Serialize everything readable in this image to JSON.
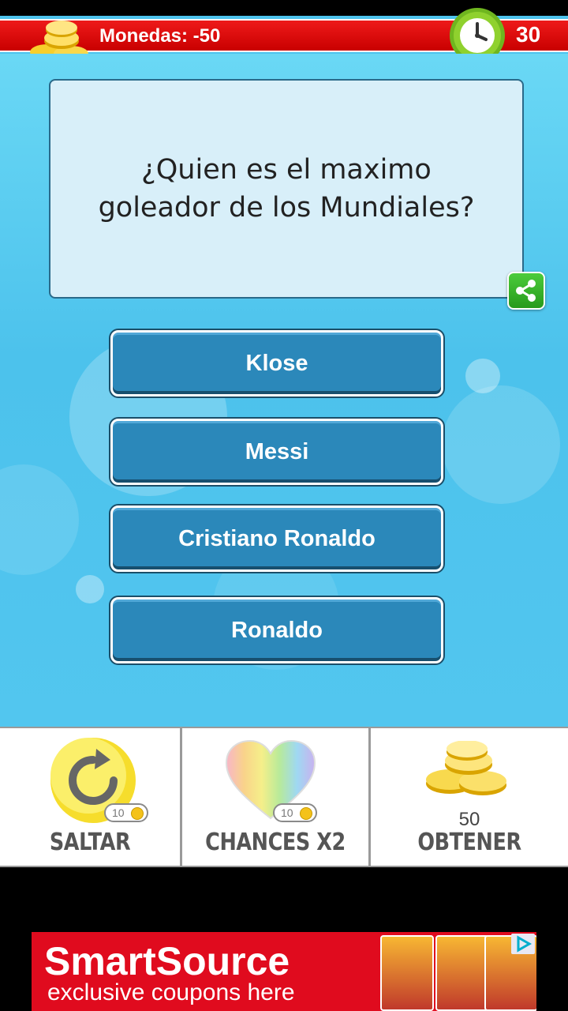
{
  "header": {
    "coins_label": "Monedas: -50",
    "timer": "30",
    "colors": {
      "bar": "#e31010",
      "clock": "#7cc62d"
    }
  },
  "question": {
    "text": "¿Quien es el maximo goleador de los Mundiales?",
    "share_icon": "share-icon"
  },
  "answers": [
    {
      "label": "Klose"
    },
    {
      "label": "Messi"
    },
    {
      "label": "Cristiano Ronaldo"
    },
    {
      "label": "Ronaldo"
    }
  ],
  "powerups": {
    "skip": {
      "label": "SALTAR",
      "cost": "10",
      "icon": "refresh-icon"
    },
    "double": {
      "label": "CHANCES X2",
      "cost": "10",
      "icon": "rainbow-heart-icon"
    },
    "coins": {
      "amount": "50",
      "label": "OBTENER",
      "icon": "coin-stack-icon"
    }
  },
  "ad": {
    "brand": "SmartSource",
    "tagline": "exclusive coupons here",
    "accent": "#e00b1e"
  }
}
